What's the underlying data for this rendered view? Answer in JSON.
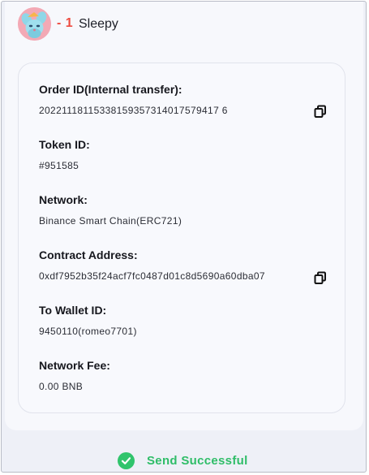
{
  "nft": {
    "quantity": "- 1",
    "name": "Sleepy"
  },
  "details": {
    "order_id_label": "Order ID(Internal transfer):",
    "order_id_value": "20221118115338159357314017579417 6",
    "token_id_label": "Token ID:",
    "token_id_value": "#951585",
    "network_label": "Network:",
    "network_value": "Binance Smart Chain(ERC721)",
    "contract_label": "Contract Address:",
    "contract_value": "0xdf7952b35f24acf7fc0487d01c8d5690a60dba07",
    "wallet_label": "To Wallet ID:",
    "wallet_value": "9450110(romeo7701)",
    "fee_label": "Network Fee:",
    "fee_value": "0.00 BNB"
  },
  "status": {
    "text": "Send Successful"
  },
  "colors": {
    "quantity": "#ee4b40",
    "success": "#30c46c",
    "avatar_bg": "#f3a9b5"
  },
  "icons": {
    "copy": "copy-icon",
    "success": "check-circle-icon",
    "avatar": "nft-avatar"
  }
}
